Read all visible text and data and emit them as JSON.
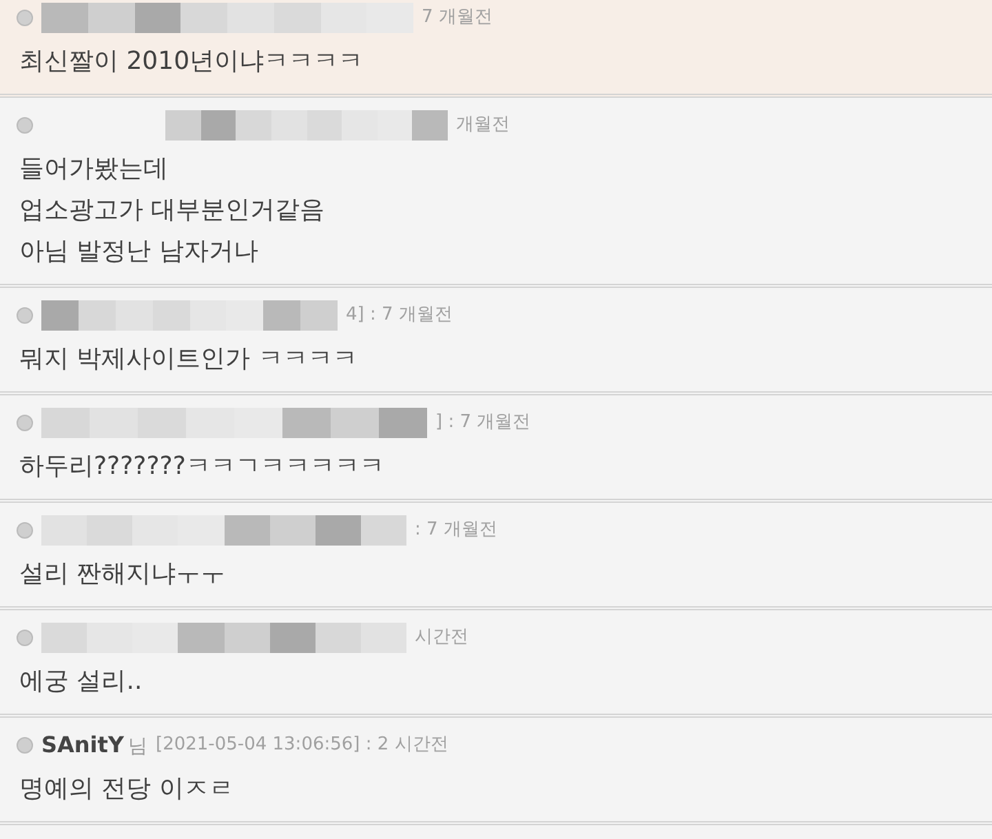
{
  "comments": [
    {
      "redacted": true,
      "highlighted": true,
      "meta": "7 개월전",
      "lines": [
        "최신짤이 2010년이냐ㅋㅋㅋㅋ"
      ]
    },
    {
      "redacted": true,
      "highlighted": false,
      "meta": "개월전",
      "lines": [
        "들어가봤는데",
        "업소광고가 대부분인거같음",
        "아님 발정난 남자거나"
      ]
    },
    {
      "redacted": true,
      "highlighted": false,
      "meta": "4] : 7 개월전",
      "lines": [
        "뭐지 박제사이트인가 ㅋㅋㅋㅋ"
      ]
    },
    {
      "redacted": true,
      "highlighted": false,
      "meta": "] : 7 개월전",
      "lines": [
        "하두리???????ㅋㅋㄱㅋㅋㅋㅋㅋ"
      ]
    },
    {
      "redacted": true,
      "highlighted": false,
      "meta": ": 7 개월전",
      "lines": [
        "설리 짠해지냐ㅜㅜ"
      ]
    },
    {
      "redacted": true,
      "highlighted": false,
      "meta": "시간전",
      "lines": [
        "에궁 설리.."
      ]
    },
    {
      "redacted": false,
      "highlighted": false,
      "name": "SAnitY",
      "honorific": "님",
      "meta": "[2021-05-04 13:06:56] : 2 시간전",
      "lines": [
        "명예의 전당 이ㅈㄹ"
      ]
    }
  ]
}
